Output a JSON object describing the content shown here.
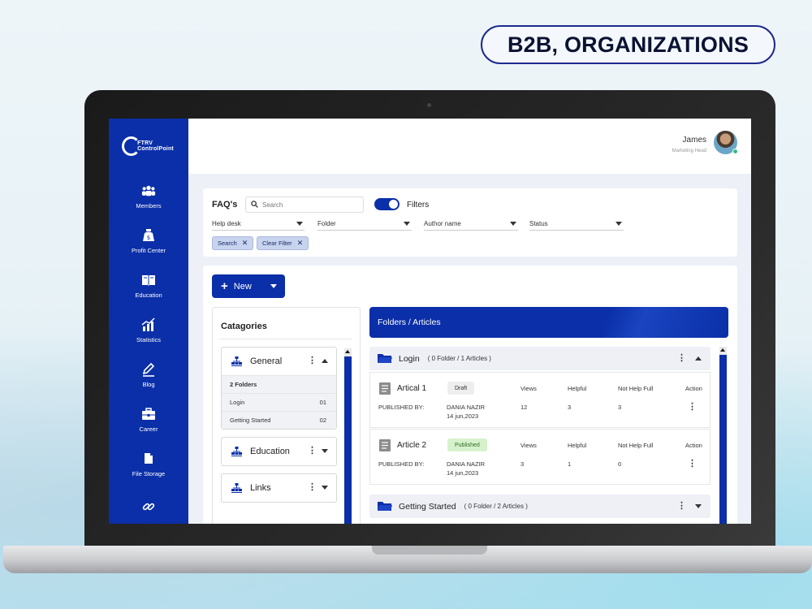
{
  "badge": "B2B, ORGANIZATIONS",
  "logo": "FTRV ControlPoint",
  "sidebar": {
    "items": [
      {
        "label": "Members",
        "icon": "members-icon"
      },
      {
        "label": "Profit Center",
        "icon": "money-bag-icon"
      },
      {
        "label": "Education",
        "icon": "book-icon"
      },
      {
        "label": "Statistics",
        "icon": "chart-icon"
      },
      {
        "label": "Blog",
        "icon": "pen-icon"
      },
      {
        "label": "Career",
        "icon": "briefcase-icon"
      },
      {
        "label": "File Storage",
        "icon": "file-icon"
      },
      {
        "label": "",
        "icon": "link-icon"
      }
    ]
  },
  "user": {
    "name": "James",
    "role": "Marketing Head"
  },
  "filters": {
    "title": "FAQ's",
    "search_placeholder": "Search",
    "toggle_label": "Filters",
    "dropdowns": [
      "Help desk",
      "Folder",
      "Author name",
      "Status"
    ],
    "chips": [
      "Search",
      "Clear Filter"
    ]
  },
  "main": {
    "new_label": "New",
    "categories_title": "Catagories",
    "categories": [
      {
        "name": "General",
        "expanded": true,
        "rows": [
          {
            "label": "2 Folders",
            "value": ""
          },
          {
            "label": "Login",
            "value": "01"
          },
          {
            "label": "Getting Started",
            "value": "02"
          }
        ]
      },
      {
        "name": "Education",
        "expanded": false
      },
      {
        "name": "Links",
        "expanded": false
      }
    ],
    "articles_title": "Folders / Articles",
    "folders": [
      {
        "name": "Login",
        "count": "( 0 Folder / 1 Articles )"
      },
      {
        "name": "Getting Started",
        "count": "( 0 Folder / 2 Articles )"
      }
    ],
    "articles": [
      {
        "title": "Artical 1",
        "status": "Draft",
        "published_by_label": "PUBLISHED BY:",
        "author": "DANIA NAZIR",
        "date": "14 jun,2023",
        "views_label": "Views",
        "views": "12",
        "helpful_label": "Helpful",
        "helpful": "3",
        "not_helpful_label": "Not Help Full",
        "not_helpful": "3",
        "action_label": "Action"
      },
      {
        "title": "Article 2",
        "status": "Published",
        "published_by_label": "PUBLISHED BY:",
        "author": "DANIA NAZIR",
        "date": "14 jun,2023",
        "views_label": "Views",
        "views": "3",
        "helpful_label": "Helpful",
        "helpful": "1",
        "not_helpful_label": "Not Help Full",
        "not_helpful": "0",
        "action_label": "Action"
      }
    ]
  },
  "colors": {
    "primary": "#0a2fa8",
    "published_bg": "#d6f2cc",
    "draft_bg": "#eeeeee"
  }
}
